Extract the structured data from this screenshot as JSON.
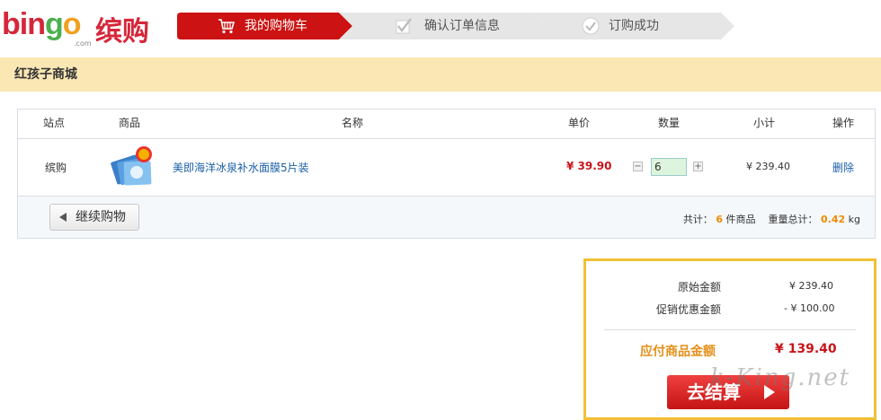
{
  "logo": {
    "brand": "bingo",
    "dotcom": ".com",
    "cn": "缤购"
  },
  "steps": [
    {
      "label": "我的购物车",
      "active": true,
      "icon": "cart-icon"
    },
    {
      "label": "确认订单信息",
      "active": false,
      "icon": "check-icon"
    },
    {
      "label": "订购成功",
      "active": false,
      "icon": "check-circle-icon"
    }
  ],
  "store": {
    "name": "红孩子商城"
  },
  "cart": {
    "headers": {
      "site": "站点",
      "product": "商品",
      "name": "名称",
      "unit_price": "单价",
      "quantity": "数量",
      "subtotal": "小计",
      "action": "操作"
    },
    "items": [
      {
        "site": "缤购",
        "name": "美即海洋冰泉补水面膜5片装",
        "price": "¥ 39.90",
        "quantity": "6",
        "subtotal": "¥ 239.40",
        "delete": "删除"
      }
    ],
    "continue_label": "继续购物",
    "summary": {
      "count_prefix": "共计：",
      "count": "6",
      "count_suffix": "件商品",
      "weight_prefix": "重量总计：",
      "weight": "0.42",
      "weight_unit": "kg"
    }
  },
  "totals": {
    "original_label": "原始金额",
    "original_value": "¥ 239.40",
    "discount_label": "促销优惠金额",
    "discount_value": "- ¥ 100.00",
    "pay_label": "应付商品金额",
    "pay_value": "¥ 139.40",
    "checkout_label": "去结算"
  },
  "colors": {
    "accent_red": "#cc1212",
    "store_bar": "#fbe7b4",
    "totals_border": "#f2c036",
    "price_red": "#c8151b",
    "link_blue": "#1a5fa8"
  }
}
